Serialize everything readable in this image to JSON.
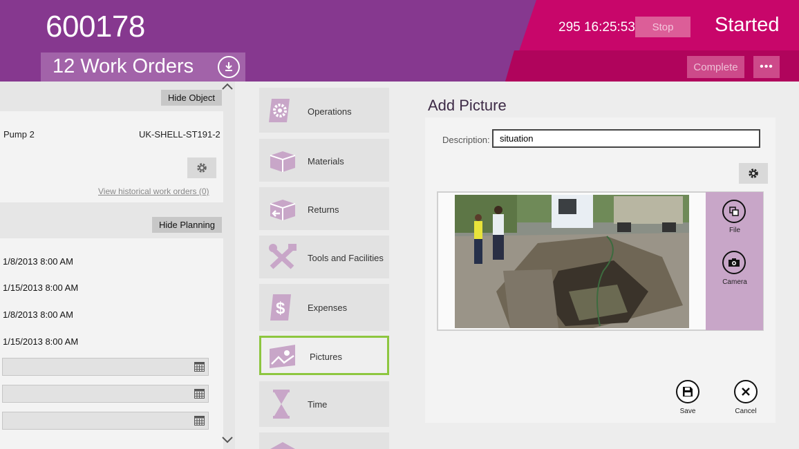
{
  "header": {
    "work_order_number": "600178",
    "work_orders_label": "12 Work Orders",
    "timer": "295 16:25:53",
    "stop_label": "Stop",
    "status": "Started",
    "complete_label": "Complete",
    "more_label": "•••"
  },
  "object_section": {
    "hide_button": "Hide Object",
    "object_name": "Pump 2",
    "object_id": "UK-SHELL-ST191-2",
    "history_link": "View historical work orders (0)"
  },
  "planning_section": {
    "hide_button": "Hide Planning",
    "dates": [
      "1/8/2013 8:00 AM",
      "1/15/2013 8:00 AM",
      "1/8/2013 8:00 AM",
      "1/15/2013 8:00 AM"
    ]
  },
  "nav": {
    "items": [
      {
        "label": "Operations",
        "icon": "gear-doc-icon"
      },
      {
        "label": "Materials",
        "icon": "box-icon"
      },
      {
        "label": "Returns",
        "icon": "return-box-icon"
      },
      {
        "label": "Tools and Facilities",
        "icon": "tools-icon"
      },
      {
        "label": "Expenses",
        "icon": "dollar-doc-icon"
      },
      {
        "label": "Pictures",
        "icon": "picture-icon"
      },
      {
        "label": "Time",
        "icon": "hourglass-icon"
      }
    ],
    "selected": "Pictures"
  },
  "add_picture": {
    "title": "Add Picture",
    "description_label": "Description:",
    "description_value": "situation",
    "file_label": "File",
    "camera_label": "Camera",
    "save_label": "Save",
    "cancel_label": "Cancel"
  },
  "colors": {
    "header_purple": "#86388f",
    "header_magenta": "#c8066a",
    "tile_purple": "#a263a9",
    "icon_lilac": "#c8a6c8",
    "selected_green": "#8dc63f"
  }
}
